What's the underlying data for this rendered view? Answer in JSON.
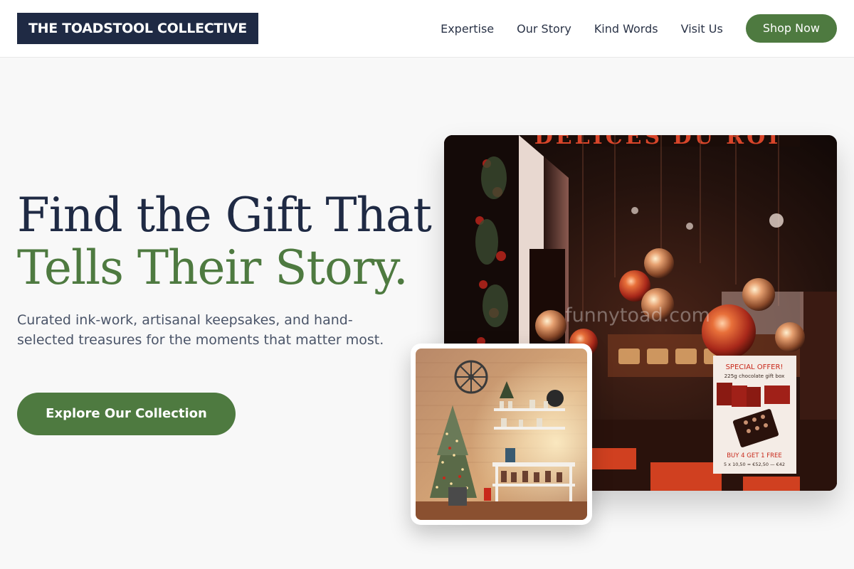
{
  "brand": {
    "name": "THE TOADSTOOL COLLECTIVE"
  },
  "nav": {
    "links": [
      "Expertise",
      "Our Story",
      "Kind Words",
      "Visit Us"
    ],
    "cta_label": "Shop Now"
  },
  "hero": {
    "headline_line1": "Find the Gift That",
    "headline_line2": "Tells Their Story.",
    "subtext": "Curated ink-work, artisanal keepsakes, and hand-selected treasures for the moments that matter most.",
    "cta_label": "Explore Our Collection"
  },
  "images": {
    "storefront": {
      "sign_text": "DELICES DU ROI",
      "watermark": "funnytoad.com",
      "poster": {
        "heading": "SPECIAL OFFER!",
        "subheading": "225g chocolate gift box",
        "promo": "BUY 4 GET 1 FREE",
        "price_line": "5 x 10,50 = €52,50 — €42"
      }
    }
  },
  "colors": {
    "brand_navy": "#1f2a44",
    "brand_green": "#4e7a40",
    "page_bg": "#f8f8f8"
  }
}
